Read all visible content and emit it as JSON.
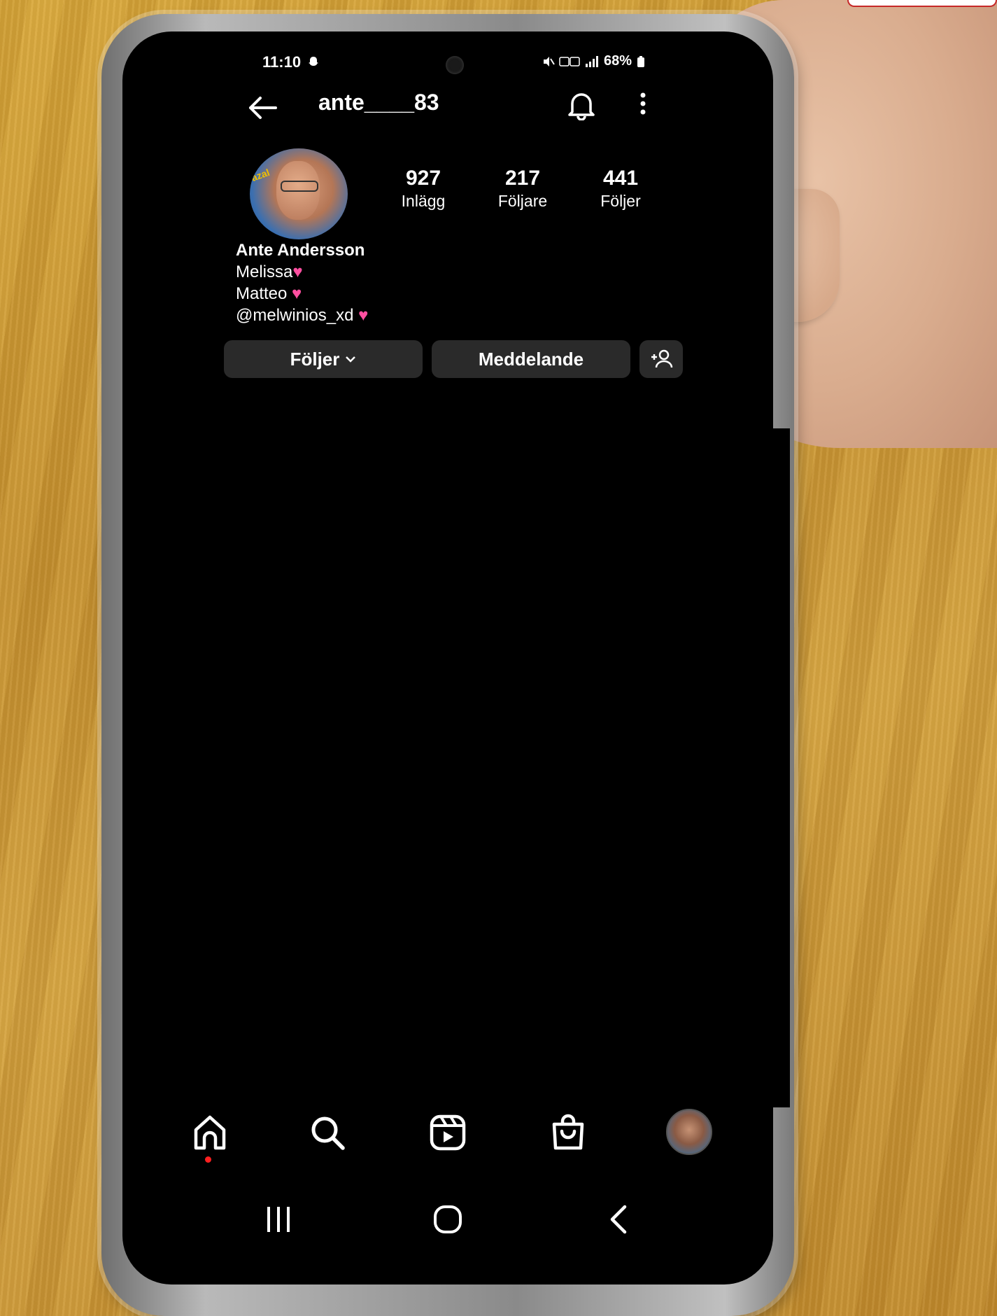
{
  "status_bar": {
    "time": "11:10",
    "battery": "68%"
  },
  "header": {
    "username": "ante____83"
  },
  "profile": {
    "stats": [
      {
        "value": "927",
        "label": "Inlägg"
      },
      {
        "value": "217",
        "label": "Följare"
      },
      {
        "value": "441",
        "label": "Följer"
      }
    ],
    "bio": {
      "name": "Ante Andersson",
      "lines": [
        "Melissa",
        "Matteo",
        "@melwinios_xd"
      ]
    }
  },
  "actions": {
    "following": "Följer",
    "message": "Meddelande"
  },
  "bottom_nav": {
    "icons": [
      "home-icon",
      "search-icon",
      "reels-icon",
      "shop-icon",
      "profile-avatar"
    ]
  },
  "system_nav": {
    "icons": [
      "recent-apps-icon",
      "home-button-icon",
      "back-icon"
    ]
  }
}
